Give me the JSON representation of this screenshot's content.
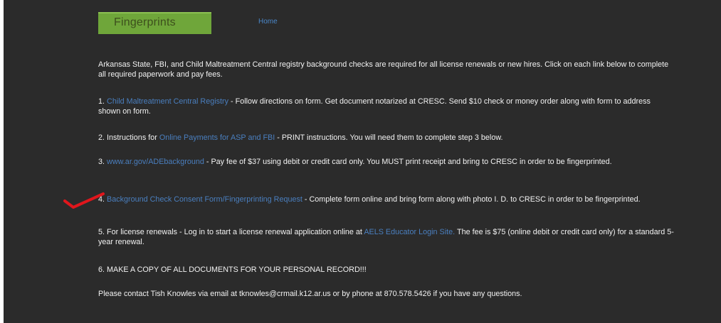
{
  "header": {
    "title": "Fingerprints",
    "home_link": "Home"
  },
  "intro": "Arkansas State, FBI, and Child Maltreatment Central registry background checks are required for all license renewals or new hires.  Click on each link below to complete all required paperwork and pay fees.",
  "steps": [
    {
      "prefix": "1.  ",
      "link": "Child Maltreatment Central Registry",
      "text": " - Follow directions on form.  Get document notarized at CRESC.  Send $10 check or money order along with form to address shown on form."
    },
    {
      "prefix": "2.  Instructions for ",
      "link": "Online Payments for ASP and FBI",
      "text": " - PRINT instructions.  You will need them to complete step 3 below."
    },
    {
      "prefix": "3.  ",
      "link": "www.ar.gov/ADEbackground",
      "text": " - Pay fee of $37 using debit or credit card only.  You MUST print receipt and bring to CRESC in order to be fingerprinted."
    },
    {
      "prefix": "4.  ",
      "link": "Background Check Consent Form/Fingerprinting Request",
      "text": " - Complete form online and bring form along with photo I. D. to CRESC in order to be fingerprinted."
    },
    {
      "prefix": "5.  For license renewals - Log in to start a license renewal application online at ",
      "link": "AELS Educator Login Site.",
      "text": "  The fee is $75 (online debit or credit card only) for a standard 5-year renewal."
    },
    {
      "text": "6.  MAKE A COPY OF ALL DOCUMENTS FOR YOUR PERSONAL RECORD!!!"
    }
  ],
  "contact": "Please contact Tish Knowles via email at tknowles@crmail.k12.ar.us or by phone at 870.578.5426 if you have any questions.",
  "colors": {
    "background": "#2b2b2b",
    "title_box": "#6fa63a",
    "link": "#4a7fbf",
    "checkmark": "#e0161c"
  },
  "annotation": {
    "icon": "red-checkmark-icon"
  }
}
